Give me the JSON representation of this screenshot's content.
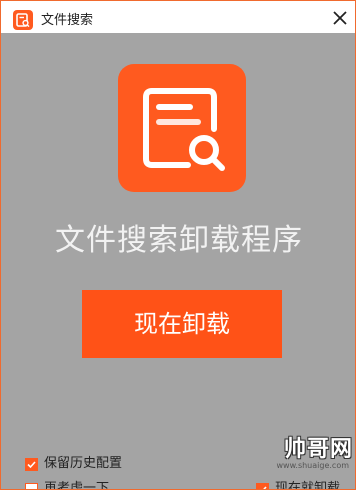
{
  "window": {
    "title": "文件搜索",
    "app_icon": "file-search-icon",
    "close_icon": "close-icon",
    "accent_color": "#ff5a1f"
  },
  "main": {
    "app_name": "文件搜索卸载程序",
    "uninstall_button_label": "现在卸载"
  },
  "options": {
    "keep_config": {
      "label": "保留历史配置",
      "checked": true
    },
    "reconsider": {
      "label": "再考虑一下",
      "checked": false
    },
    "uninstall_now": {
      "label": "现在就卸载",
      "checked": true
    }
  },
  "watermark": {
    "text": "帅哥网",
    "url": "www.shuaige.com"
  }
}
